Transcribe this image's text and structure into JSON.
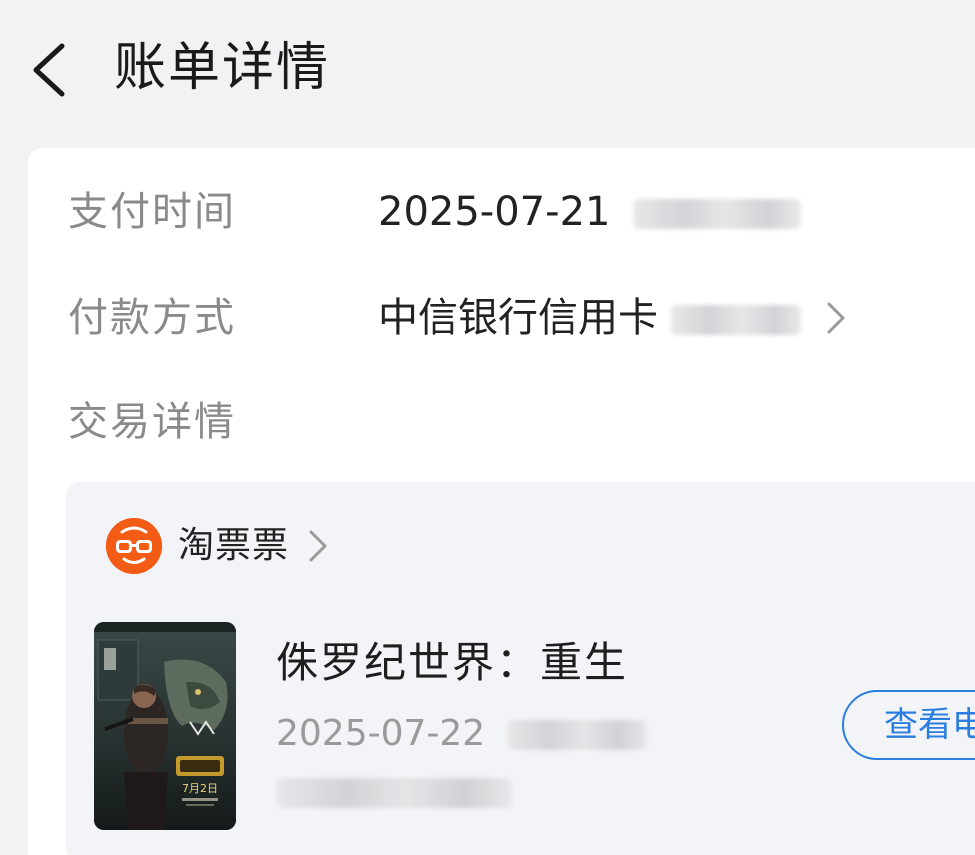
{
  "header": {
    "title": "账单详情",
    "back_icon": "chevron-left-icon"
  },
  "details": {
    "pay_time": {
      "label": "支付时间",
      "value": "2025-07-21"
    },
    "pay_method": {
      "label": "付款方式",
      "value": "中信银行信用卡"
    },
    "trade_detail": {
      "label": "交易详情"
    }
  },
  "trade": {
    "merchant": {
      "name": "淘票票",
      "logo_color": "#f45b14"
    },
    "movie": {
      "title": "侏罗纪世界：重生",
      "date": "2025-07-22",
      "poster_text": "7月2日"
    },
    "view_button": "查看电"
  },
  "colors": {
    "accent": "#2a7ee0",
    "label_gray": "#8a8a8a",
    "background": "#f2f2f4"
  }
}
